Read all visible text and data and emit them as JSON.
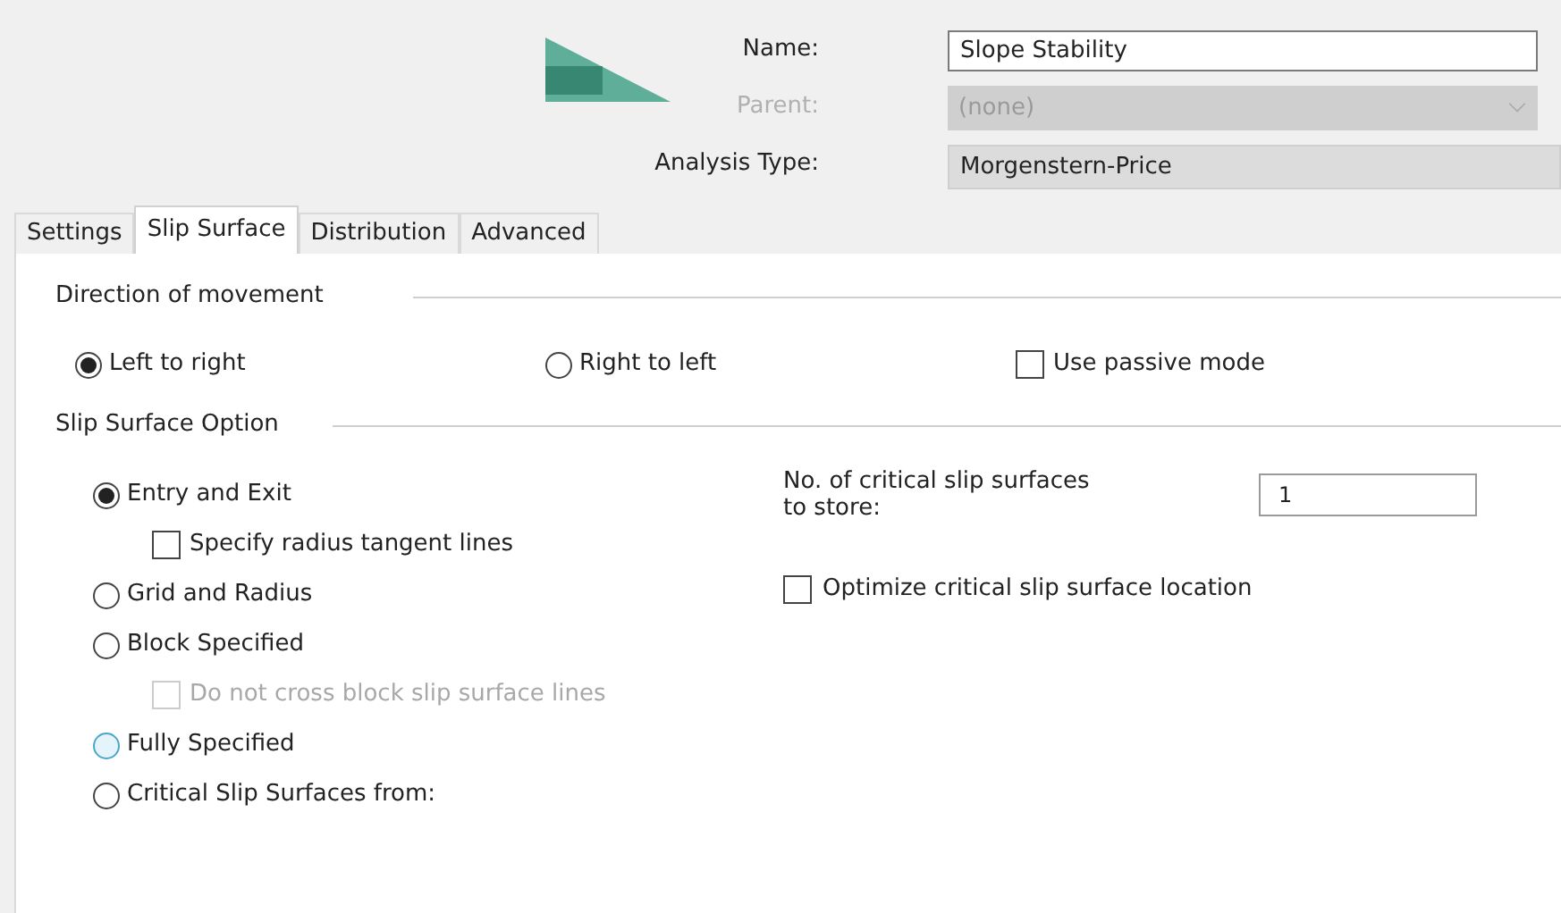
{
  "header": {
    "fields": [
      {
        "label": "Name:",
        "value": "Slope Stability",
        "kind": "text",
        "disabled": false
      },
      {
        "label": "Parent:",
        "value": "(none)",
        "kind": "dropdown",
        "disabled": true
      },
      {
        "label": "Analysis Type:",
        "value": "Morgenstern-Price",
        "kind": "readonly",
        "disabled": false
      }
    ]
  },
  "tabs": [
    {
      "label": "Settings",
      "selected": false
    },
    {
      "label": "Slip Surface",
      "selected": true
    },
    {
      "label": "Distribution",
      "selected": false
    },
    {
      "label": "Advanced",
      "selected": false
    }
  ],
  "direction": {
    "title": "Direction of movement",
    "options": [
      {
        "label": "Left to right",
        "selected": true
      },
      {
        "label": "Right to left",
        "selected": false
      }
    ],
    "passive": {
      "label": "Use passive mode",
      "checked": false
    }
  },
  "slip_option": {
    "title": "Slip Surface Option",
    "items": [
      {
        "kind": "radio",
        "label": "Entry and Exit",
        "selected": true,
        "focused": false
      },
      {
        "kind": "check",
        "label": "Specify radius tangent lines",
        "checked": false,
        "disabled": false
      },
      {
        "kind": "radio",
        "label": "Grid and Radius",
        "selected": false,
        "focused": false
      },
      {
        "kind": "radio",
        "label": "Block Specified",
        "selected": false,
        "focused": false
      },
      {
        "kind": "check",
        "label": "Do not cross block slip surface lines",
        "checked": false,
        "disabled": true
      },
      {
        "kind": "radio",
        "label": "Fully Specified",
        "selected": false,
        "focused": true
      },
      {
        "kind": "radio",
        "label": "Critical Slip Surfaces from:",
        "selected": false,
        "focused": false
      }
    ],
    "store_label": "No. of critical slip surfaces to store:",
    "store_value": "1",
    "optimize": {
      "label": "Optimize critical slip surface location",
      "checked": false
    }
  }
}
